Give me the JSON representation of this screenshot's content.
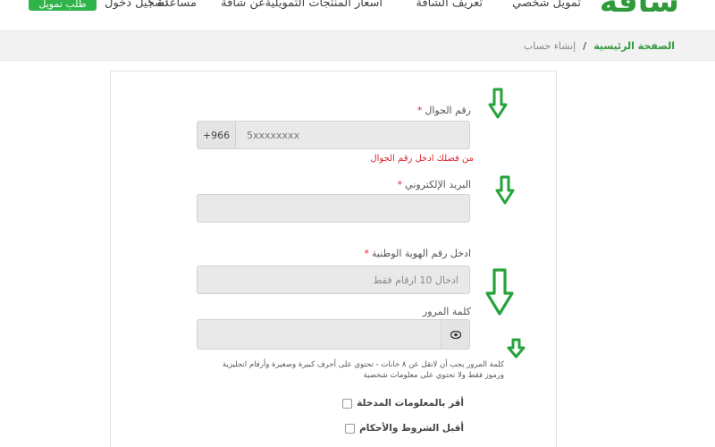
{
  "header": {
    "logo": "شافة",
    "nav": [
      {
        "label": "تمويل شخصي"
      },
      {
        "label": "تعريف الشافة"
      },
      {
        "label": "اسعار المنتجات التمويلية"
      },
      {
        "label": "عن شافة"
      },
      {
        "label": "مساعدة ؟"
      }
    ],
    "login_label": "تسجيل دخول",
    "register_label": "طلب تمويل"
  },
  "breadcrumb": {
    "home": "الصفحة الرئيسية",
    "separator": "/",
    "current": "إنشاء حساب"
  },
  "form": {
    "phone": {
      "label": "رقم الجوال",
      "required_mark": "*",
      "prefix": "+966",
      "placeholder": "5xxxxxxxx",
      "error": "من فضلك ادخل رقم الجوال"
    },
    "email": {
      "label": "البريد الإلكتروني",
      "required_mark": "*",
      "value": ""
    },
    "national_id": {
      "label": "ادخل رقم الهوية الوطنية",
      "required_mark": "*",
      "placeholder": "ادخال 10 ارقام فقط"
    },
    "password": {
      "label": "كلمة المرور",
      "value": "",
      "hint": "كلمة المرور يجب أن لاتقل عن ٨ خانات - تحتوي على أحرف كبيرة وصغيرة وأرقام انجليزية ورموز فقط ولا تحتوي على معلومات شخصية"
    },
    "checkboxes": [
      {
        "label": "أقر بالمعلومات المدخلة",
        "checked": false
      },
      {
        "label": "أقبل الشروط والأحكام",
        "checked": false
      }
    ]
  },
  "colors": {
    "brand_green": "#2e9a3a",
    "button_green": "#2fb44a",
    "error_red": "#d9232a",
    "annotation_arrow": "#27a33b"
  },
  "icons": {
    "password_toggle": "eye-icon",
    "annotation": "down-arrow-icon"
  }
}
